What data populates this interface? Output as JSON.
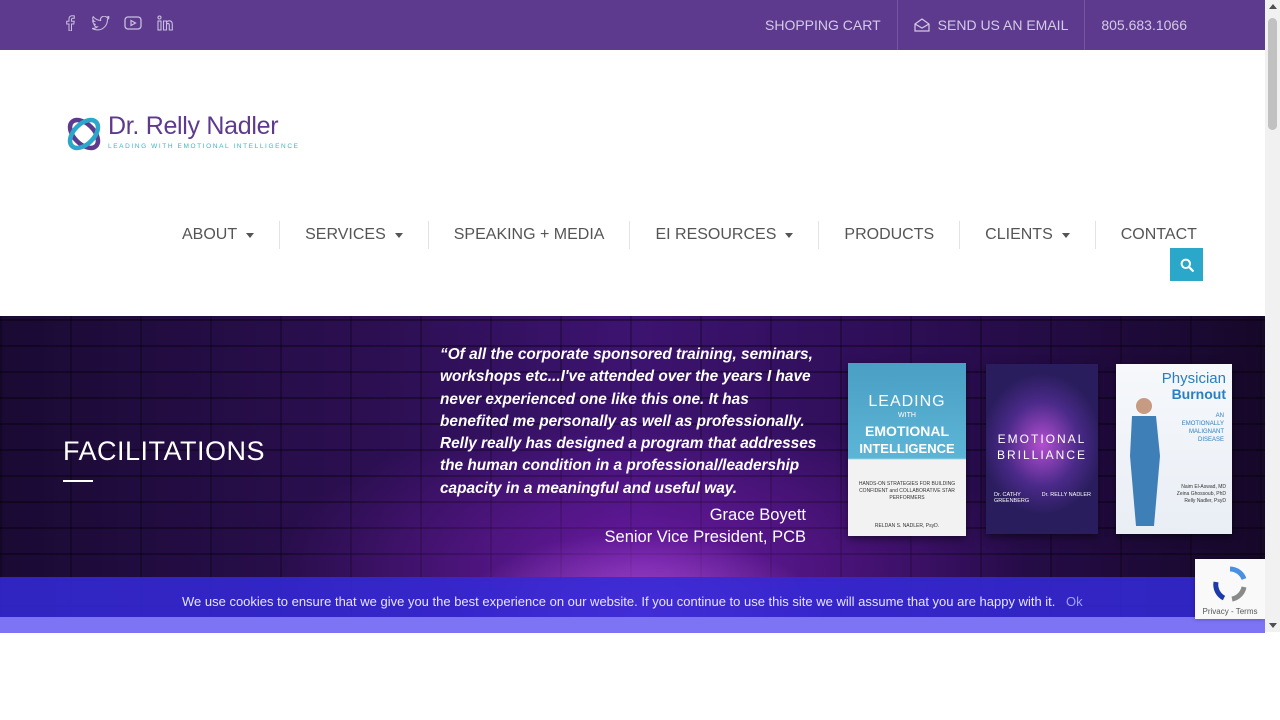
{
  "topbar": {
    "social": [
      "facebook-icon",
      "twitter-icon",
      "youtube-icon",
      "linkedin-icon"
    ],
    "shopping_cart": "SHOPPING CART",
    "email": "SEND US AN EMAIL",
    "phone": "805.683.1066"
  },
  "logo": {
    "name": "Dr. Relly Nadler",
    "tagline": "LEADING WITH EMOTIONAL INTELLIGENCE"
  },
  "nav": {
    "items": [
      {
        "label": "ABOUT",
        "dropdown": true
      },
      {
        "label": "SERVICES",
        "dropdown": true
      },
      {
        "label": "SPEAKING + MEDIA",
        "dropdown": false
      },
      {
        "label": "EI RESOURCES",
        "dropdown": true
      },
      {
        "label": "PRODUCTS",
        "dropdown": false
      },
      {
        "label": "CLIENTS",
        "dropdown": true
      },
      {
        "label": "CONTACT",
        "dropdown": false
      }
    ]
  },
  "hero": {
    "title": "FACILITATIONS",
    "quote": "“Of all the corporate sponsored training, seminars, workshops etc...I've attended over the years I have never experienced one like this one. It has benefited me personally as well as professionally. Relly really has designed a program that addresses the human condition in a professional/leadership capacity in a meaningful and useful way.",
    "author": "Grace Boyett",
    "author_title": "Senior Vice President, PCB",
    "books": [
      {
        "title_line1": "LEADING",
        "title_line2": "WITH",
        "title_line3": "EMOTIONAL",
        "title_line4": "INTELLIGENCE",
        "subtitle": "HANDS-ON STRATEGIES FOR BUILDING CONFIDENT and COLLABORATIVE STAR PERFORMERS",
        "author": "RELDAN S. NADLER, PsyD."
      },
      {
        "title_line1": "EMOTIONAL",
        "title_line2": "BRILLIANCE",
        "author1": "Dr. CATHY GREENBERG",
        "author2": "Dr. RELLY NADLER"
      },
      {
        "title_line1": "Physician",
        "title_line2": "Burnout",
        "subtitle": "AN EMOTIONALLY MALIGNANT DISEASE",
        "authors": "Naim El-Aswad, MD Zeina Ghossoub, PhD Relly Nadler, PsyD"
      }
    ]
  },
  "cookie": {
    "text": "We use cookies to ensure that we give you the best experience on our website. If you continue to use this site we will assume that you are happy with it.",
    "ok": "Ok"
  },
  "recaptcha": {
    "links": "Privacy - Terms"
  },
  "colors": {
    "topbar": "#5d3a8e",
    "accent": "#2aa7c9",
    "cookie_bar": "#3429d6"
  }
}
